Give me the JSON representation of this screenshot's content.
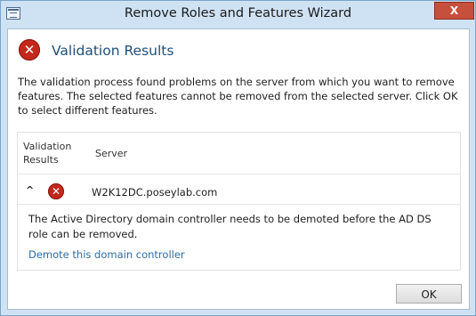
{
  "window": {
    "title": "Remove Roles and Features Wizard",
    "close_glyph": "X"
  },
  "header": {
    "heading": "Validation Results",
    "icon": "error-icon"
  },
  "description": "The validation process found problems on the server from which you want to remove features. The selected features cannot be removed from the selected server.  Click OK to select different features.",
  "results": {
    "columns": {
      "validation_line1": "Validation",
      "validation_line2": "Results",
      "server": "Server"
    },
    "row": {
      "expand_glyph": "^",
      "status_icon": "error-icon",
      "server": "W2K12DC.poseylab.com",
      "detail": "The Active Directory domain controller needs to be demoted before the AD DS role can be removed.",
      "link": "Demote this domain controller"
    }
  },
  "footer": {
    "ok_label": "OK"
  },
  "colors": {
    "frame": "#cfe2f4",
    "error_red": "#c4281c",
    "heading_blue": "#1f4e79",
    "link_blue": "#2b6ea8",
    "close_red": "#c7503c"
  }
}
